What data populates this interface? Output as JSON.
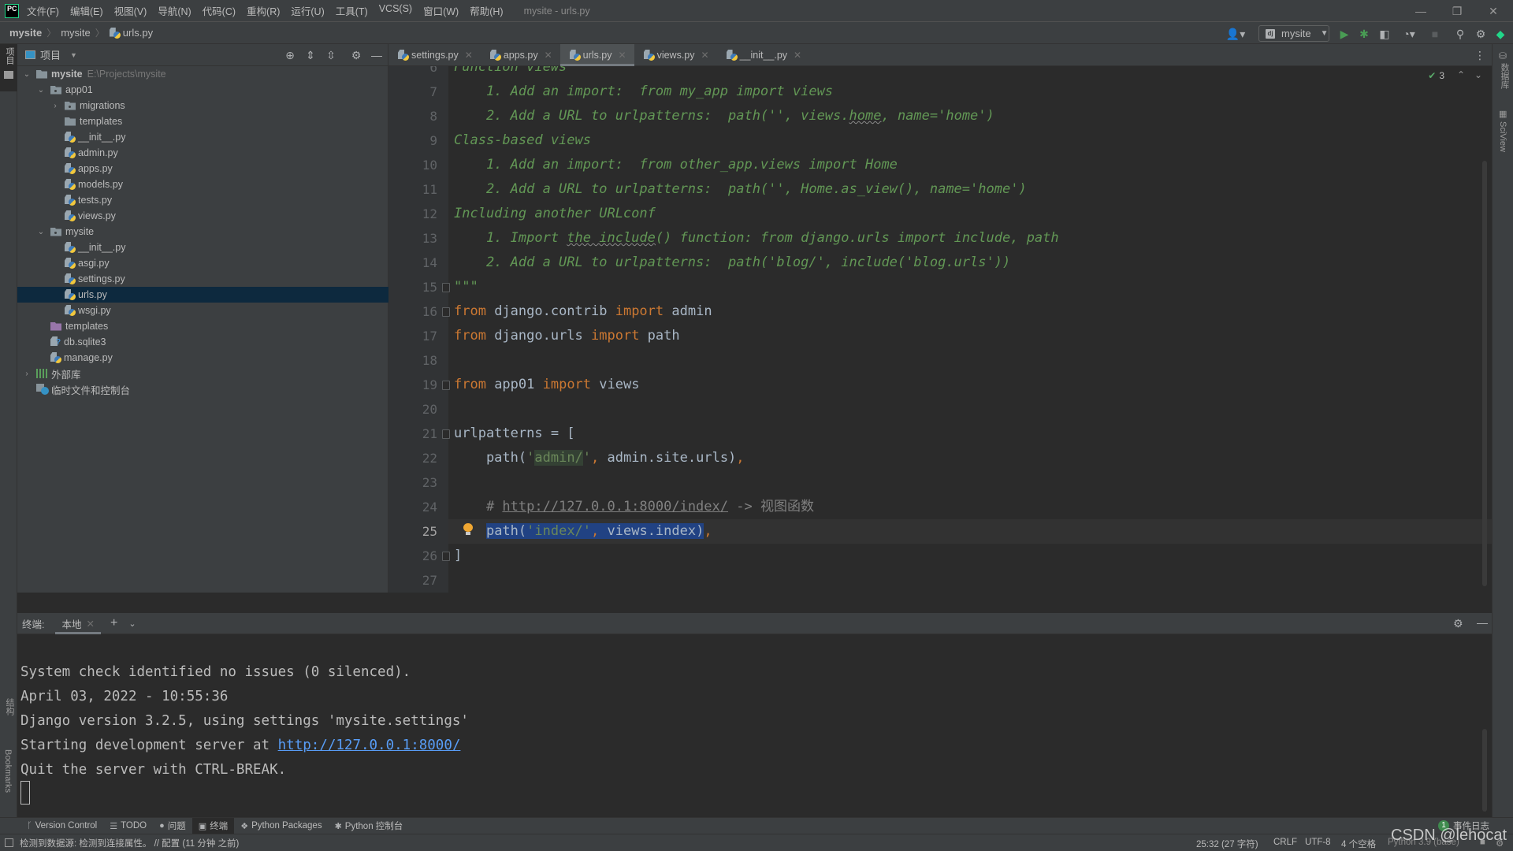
{
  "window": {
    "title": "mysite - urls.py",
    "menu": [
      "文件(F)",
      "编辑(E)",
      "视图(V)",
      "导航(N)",
      "代码(C)",
      "重构(R)",
      "运行(U)",
      "工具(T)",
      "VCS(S)",
      "窗口(W)",
      "帮助(H)"
    ],
    "logo": "PC"
  },
  "breadcrumb": [
    "mysite",
    "mysite",
    "urls.py"
  ],
  "toolbar": {
    "run_config": "mysite",
    "run_config_icon": "dj"
  },
  "left_strip": {
    "project_label": "项目",
    "structure_label": "结构",
    "bookmarks_label": "Bookmarks"
  },
  "right_strip": {
    "database_label": "数据库",
    "sciview_label": "SciView"
  },
  "project": {
    "header": "项目",
    "tree": [
      {
        "depth": 0,
        "type": "folder",
        "name": "mysite",
        "hint": "E:\\Projects\\mysite",
        "expanded": true,
        "bold": true
      },
      {
        "depth": 1,
        "type": "module",
        "name": "app01",
        "expanded": true
      },
      {
        "depth": 2,
        "type": "module",
        "name": "migrations",
        "expanded": false
      },
      {
        "depth": 2,
        "type": "folder",
        "name": "templates"
      },
      {
        "depth": 2,
        "type": "py",
        "name": "__init__.py"
      },
      {
        "depth": 2,
        "type": "py",
        "name": "admin.py"
      },
      {
        "depth": 2,
        "type": "py",
        "name": "apps.py"
      },
      {
        "depth": 2,
        "type": "py",
        "name": "models.py"
      },
      {
        "depth": 2,
        "type": "py",
        "name": "tests.py"
      },
      {
        "depth": 2,
        "type": "py",
        "name": "views.py"
      },
      {
        "depth": 1,
        "type": "module",
        "name": "mysite",
        "expanded": true
      },
      {
        "depth": 2,
        "type": "py",
        "name": "__init__.py"
      },
      {
        "depth": 2,
        "type": "py",
        "name": "asgi.py"
      },
      {
        "depth": 2,
        "type": "py",
        "name": "settings.py"
      },
      {
        "depth": 2,
        "type": "py",
        "name": "urls.py",
        "selected": true
      },
      {
        "depth": 2,
        "type": "py",
        "name": "wsgi.py"
      },
      {
        "depth": 1,
        "type": "purple",
        "name": "templates"
      },
      {
        "depth": 1,
        "type": "db",
        "name": "db.sqlite3"
      },
      {
        "depth": 1,
        "type": "py",
        "name": "manage.py"
      },
      {
        "depth": 0,
        "type": "lib",
        "name": "外部库",
        "expanded": false
      },
      {
        "depth": 0,
        "type": "scratch",
        "name": "临时文件和控制台"
      }
    ]
  },
  "editor": {
    "tabs": [
      {
        "label": "settings.py",
        "active": false
      },
      {
        "label": "apps.py",
        "active": false
      },
      {
        "label": "urls.py",
        "active": true
      },
      {
        "label": "views.py",
        "active": false
      },
      {
        "label": "__init__.py",
        "active": false
      }
    ],
    "inspection_count": "3",
    "current_line": 25,
    "lines": [
      {
        "n": 6,
        "segs": [
          [
            "doc",
            "Function views"
          ]
        ]
      },
      {
        "n": 7,
        "segs": [
          [
            "doc",
            "    1. Add an import:  from my_app import views"
          ]
        ]
      },
      {
        "n": 8,
        "segs": [
          [
            "doc",
            "    2. Add a URL to urlpatterns:  path('', views."
          ],
          [
            "doc squig",
            "home"
          ],
          [
            "doc",
            ", name='home')"
          ]
        ]
      },
      {
        "n": 9,
        "segs": [
          [
            "doc",
            "Class-based views"
          ]
        ]
      },
      {
        "n": 10,
        "segs": [
          [
            "doc",
            "    1. Add an import:  from other_app.views import Home"
          ]
        ]
      },
      {
        "n": 11,
        "segs": [
          [
            "doc",
            "    2. Add a URL to urlpatterns:  path('', Home.as_view(), name='home')"
          ]
        ]
      },
      {
        "n": 12,
        "segs": [
          [
            "doc",
            "Including another URLconf"
          ]
        ]
      },
      {
        "n": 13,
        "segs": [
          [
            "doc",
            "    1. Import "
          ],
          [
            "doc squig",
            "the include"
          ],
          [
            "doc",
            "() function: from django.urls import include, path"
          ]
        ]
      },
      {
        "n": 14,
        "segs": [
          [
            "doc",
            "    2. Add a URL to urlpatterns:  path('blog/', include('blog.urls'))"
          ]
        ]
      },
      {
        "n": 15,
        "segs": [
          [
            "doc",
            "\"\"\""
          ]
        ],
        "fold": true
      },
      {
        "n": 16,
        "segs": [
          [
            "kw",
            "from"
          ],
          [
            "",
            " django.contrib "
          ],
          [
            "kw",
            "import"
          ],
          [
            "",
            " admin"
          ]
        ],
        "fold": true
      },
      {
        "n": 17,
        "segs": [
          [
            "kw",
            "from"
          ],
          [
            "",
            " django.urls "
          ],
          [
            "kw",
            "import"
          ],
          [
            "",
            " path"
          ]
        ]
      },
      {
        "n": 18,
        "segs": []
      },
      {
        "n": 19,
        "segs": [
          [
            "kw",
            "from"
          ],
          [
            "",
            " app01 "
          ],
          [
            "kw",
            "import"
          ],
          [
            "",
            " views"
          ]
        ],
        "fold": true
      },
      {
        "n": 20,
        "segs": []
      },
      {
        "n": 21,
        "segs": [
          [
            "",
            "urlpatterns = ["
          ]
        ],
        "fold": true
      },
      {
        "n": 22,
        "segs": [
          [
            "",
            "    path("
          ],
          [
            "str",
            "'"
          ],
          [
            "str hl-green",
            "admin/"
          ],
          [
            "str",
            "'"
          ],
          [
            "kw",
            ","
          ],
          [
            "",
            " admin.site.urls)"
          ],
          [
            "kw",
            ","
          ]
        ]
      },
      {
        "n": 23,
        "segs": []
      },
      {
        "n": 24,
        "segs": [
          [
            "cm",
            "    # "
          ],
          [
            "link",
            "http://127.0.0.1:8000/index/"
          ],
          [
            "cm",
            " -> 视图函数"
          ]
        ]
      },
      {
        "n": 25,
        "segs": [
          [
            "",
            "    "
          ],
          [
            "sel",
            "path("
          ],
          [
            "str sel",
            "'index/'"
          ],
          [
            "kw sel",
            ","
          ],
          [
            "sel",
            " views.index)"
          ],
          [
            "kw",
            ","
          ]
        ]
      },
      {
        "n": 26,
        "segs": [
          [
            "",
            "]"
          ]
        ],
        "fold": true
      },
      {
        "n": 27,
        "segs": []
      }
    ]
  },
  "terminal": {
    "label": "终端:",
    "tabs": [
      {
        "label": "本地",
        "active": true
      }
    ],
    "lines": [
      "",
      "System check identified no issues (0 silenced).",
      "April 03, 2022 - 10:55:36",
      "Django version 3.2.5, using settings 'mysite.settings'",
      "Quit the server with CTRL-BREAK."
    ],
    "server_line_prefix": "Starting development server at ",
    "server_url": "http://127.0.0.1:8000/"
  },
  "tool_windows": [
    {
      "label": "Version Control",
      "icon": "branch-icon",
      "glyph": "ᚴ",
      "active": false
    },
    {
      "label": "TODO",
      "icon": "list-icon",
      "glyph": "☰",
      "active": false
    },
    {
      "label": "问题",
      "icon": "problems-icon",
      "glyph": "●",
      "active": false
    },
    {
      "label": "终端",
      "icon": "terminal-icon",
      "glyph": "▣",
      "active": true
    },
    {
      "label": "Python Packages",
      "icon": "packages-icon",
      "glyph": "❖",
      "active": false
    },
    {
      "label": "Python 控制台",
      "icon": "python-console-icon",
      "glyph": "✱",
      "active": false
    }
  ],
  "event_log": {
    "count": "1",
    "label": "事件日志"
  },
  "status": {
    "message": "检测到数据源: 检测到连接属性。 // 配置 (11 分钟 之前)",
    "position": "25:32 (27 字符)",
    "line_sep": "CRLF",
    "encoding": "UTF-8",
    "indent": "4 个空格",
    "interpreter": "Python 3.9 (base)"
  },
  "watermark": "CSDN @lehocat"
}
